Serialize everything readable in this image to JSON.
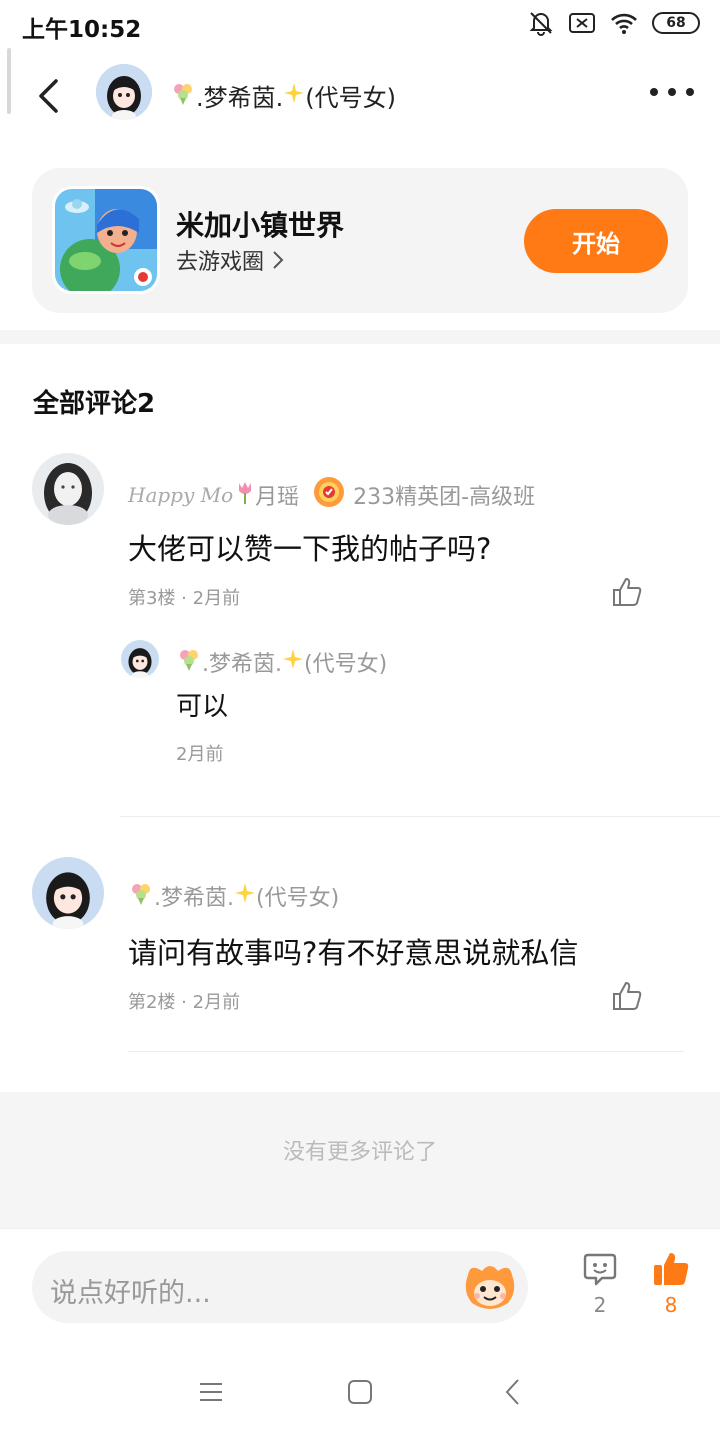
{
  "status_bar": {
    "time": "上午10:52",
    "battery": "68"
  },
  "header": {
    "name": ".梦希茵.",
    "name_suffix": "(代号女)"
  },
  "game_card": {
    "title": "米加小镇世界",
    "subtitle": "去游戏圈",
    "start_label": "开始"
  },
  "comments_section": {
    "title": "全部评论2"
  },
  "comments": [
    {
      "script_name": "Happy Mo",
      "username": "月瑶",
      "badge": "233精英团-高级班",
      "text": "大佬可以赞一下我的帖子吗?",
      "floor": "第3楼",
      "time": "2月前",
      "reply": {
        "name": ".梦希茵.",
        "name_suffix": "(代号女)",
        "text": "可以",
        "time": "2月前"
      }
    },
    {
      "username": ".梦希茵.",
      "username_suffix": "(代号女)",
      "text": "请问有故事吗?有不好意思说就私信",
      "floor": "第2楼",
      "time": "2月前"
    }
  ],
  "end_notice": "没有更多评论了",
  "bottom_bar": {
    "placeholder": "说点好听的...",
    "comment_count": "2",
    "like_count": "8"
  },
  "colors": {
    "accent": "#ff7a14",
    "card_bg": "#f4f4f4",
    "muted_text": "#999999"
  }
}
